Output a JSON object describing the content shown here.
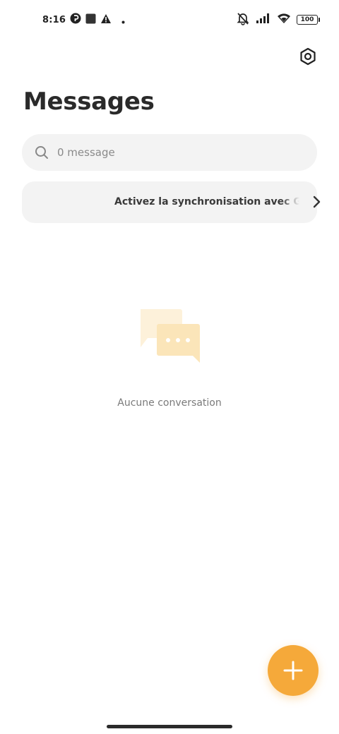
{
  "status_bar": {
    "time": "8:16",
    "battery_level": "100",
    "icons": [
      "p-icon",
      "square-notification-icon",
      "warning-icon",
      "dot-icon",
      "mute-icon",
      "signal-icon",
      "wifi-icon",
      "battery-icon"
    ]
  },
  "header": {
    "title": "Messages",
    "settings_icon": "gear-hexagon-icon"
  },
  "search": {
    "placeholder": "0 message",
    "value": ""
  },
  "sync_banner": {
    "text": "Activez la synchronisation avec Google"
  },
  "empty_state": {
    "text": "Aucune conversation"
  },
  "fab": {
    "icon": "plus-icon"
  },
  "colors": {
    "accent": "#f5a93a",
    "surface": "#f3f3f3",
    "illustration": "#fbe7bf"
  }
}
